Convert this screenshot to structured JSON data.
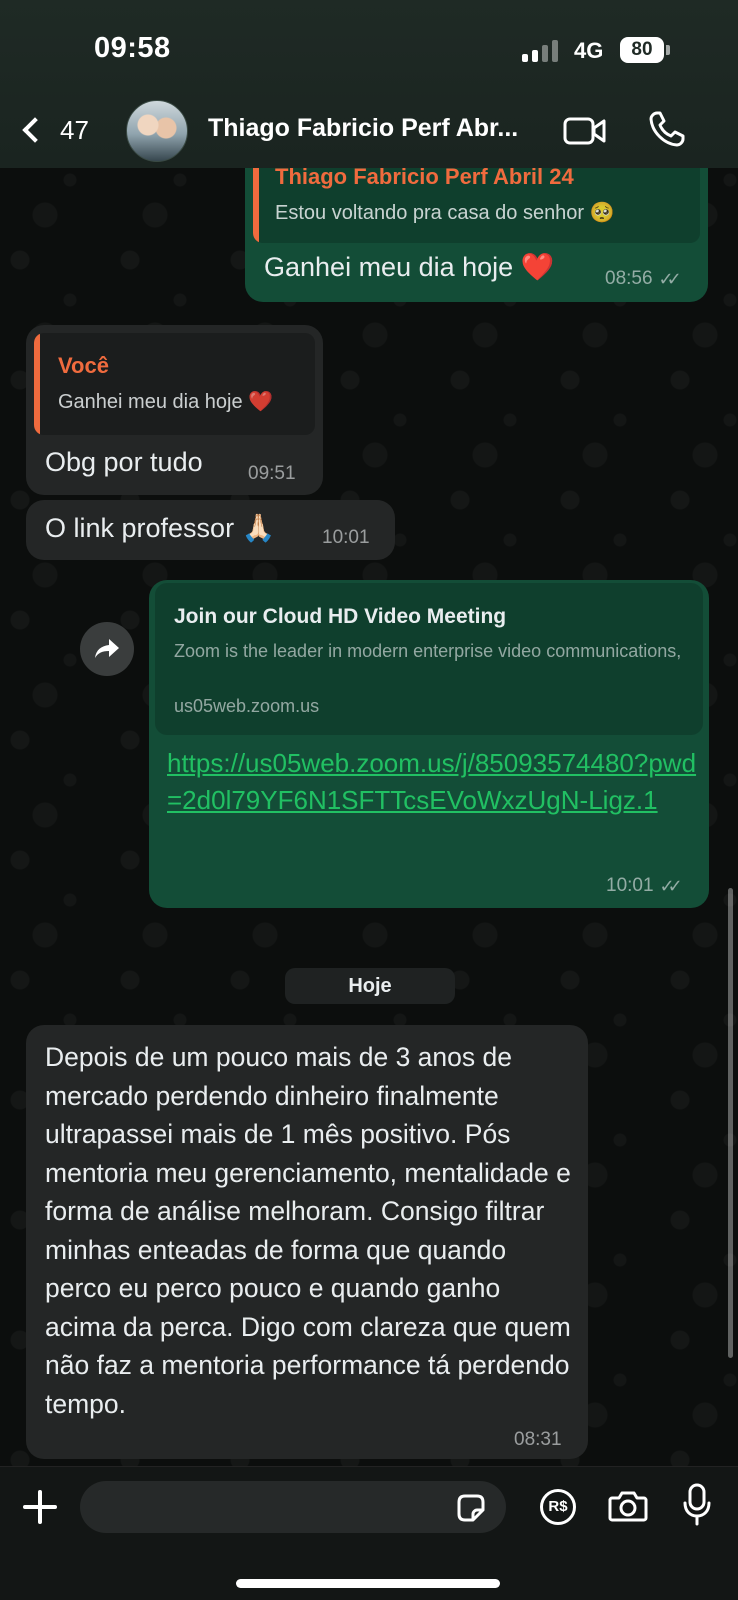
{
  "status_bar": {
    "time": "09:58",
    "network": "4G",
    "battery": "80"
  },
  "header": {
    "back_count": "47",
    "contact_name": "Thiago Fabricio Perf Abr..."
  },
  "messages": {
    "m1": {
      "quote_author": "Thiago Fabricio Perf Abril 24",
      "quote_text": "Estou voltando pra casa do senhor 🥺",
      "text": "Ganhei meu dia hoje ❤️",
      "time": "08:56"
    },
    "m2": {
      "quote_author": "Você",
      "quote_text": "Ganhei meu dia hoje ❤️",
      "text": "Obg por tudo",
      "time": "09:51"
    },
    "m3": {
      "text": "O link professor 🙏🏻",
      "time": "10:01"
    },
    "m4": {
      "preview_title": "Join our Cloud HD Video Meeting",
      "preview_desc": "Zoom is the leader in modern enterprise video communications, with an easy, reliable cloud platfo...",
      "preview_domain": "us05web.zoom.us",
      "link": "https://us05web.zoom.us/j/85093574480?pwd=2d0l79YF6N1SFTTcsEVoWxzUgN-Ligz.1",
      "time": "10:01"
    },
    "date_separator": "Hoje",
    "m5": {
      "text": "Depois de um pouco mais de 3 anos de mercado perdendo dinheiro finalmente ultrapassei mais de 1 mês positivo. Pós mentoria meu gerenciamento, mentalidade e forma de análise melhoram. Consigo filtrar minhas enteadas de forma que quando perco eu perco pouco e quando ganho acima da perca. Digo com clareza que quem não faz a mentoria performance tá perdendo tempo.",
      "time": "08:31"
    }
  },
  "input_bar": {
    "placeholder": "",
    "pay_label": "R$"
  },
  "colors": {
    "outgoing_bubble": "#134d37",
    "incoming_bubble": "#242626",
    "quote_author": "#f06b3e",
    "link": "#21c063"
  },
  "icons": [
    "chevron-left-icon",
    "video-call-icon",
    "phone-icon",
    "forward-icon",
    "plus-icon",
    "sticker-icon",
    "payment-icon",
    "camera-icon",
    "microphone-icon",
    "double-check-icon"
  ]
}
